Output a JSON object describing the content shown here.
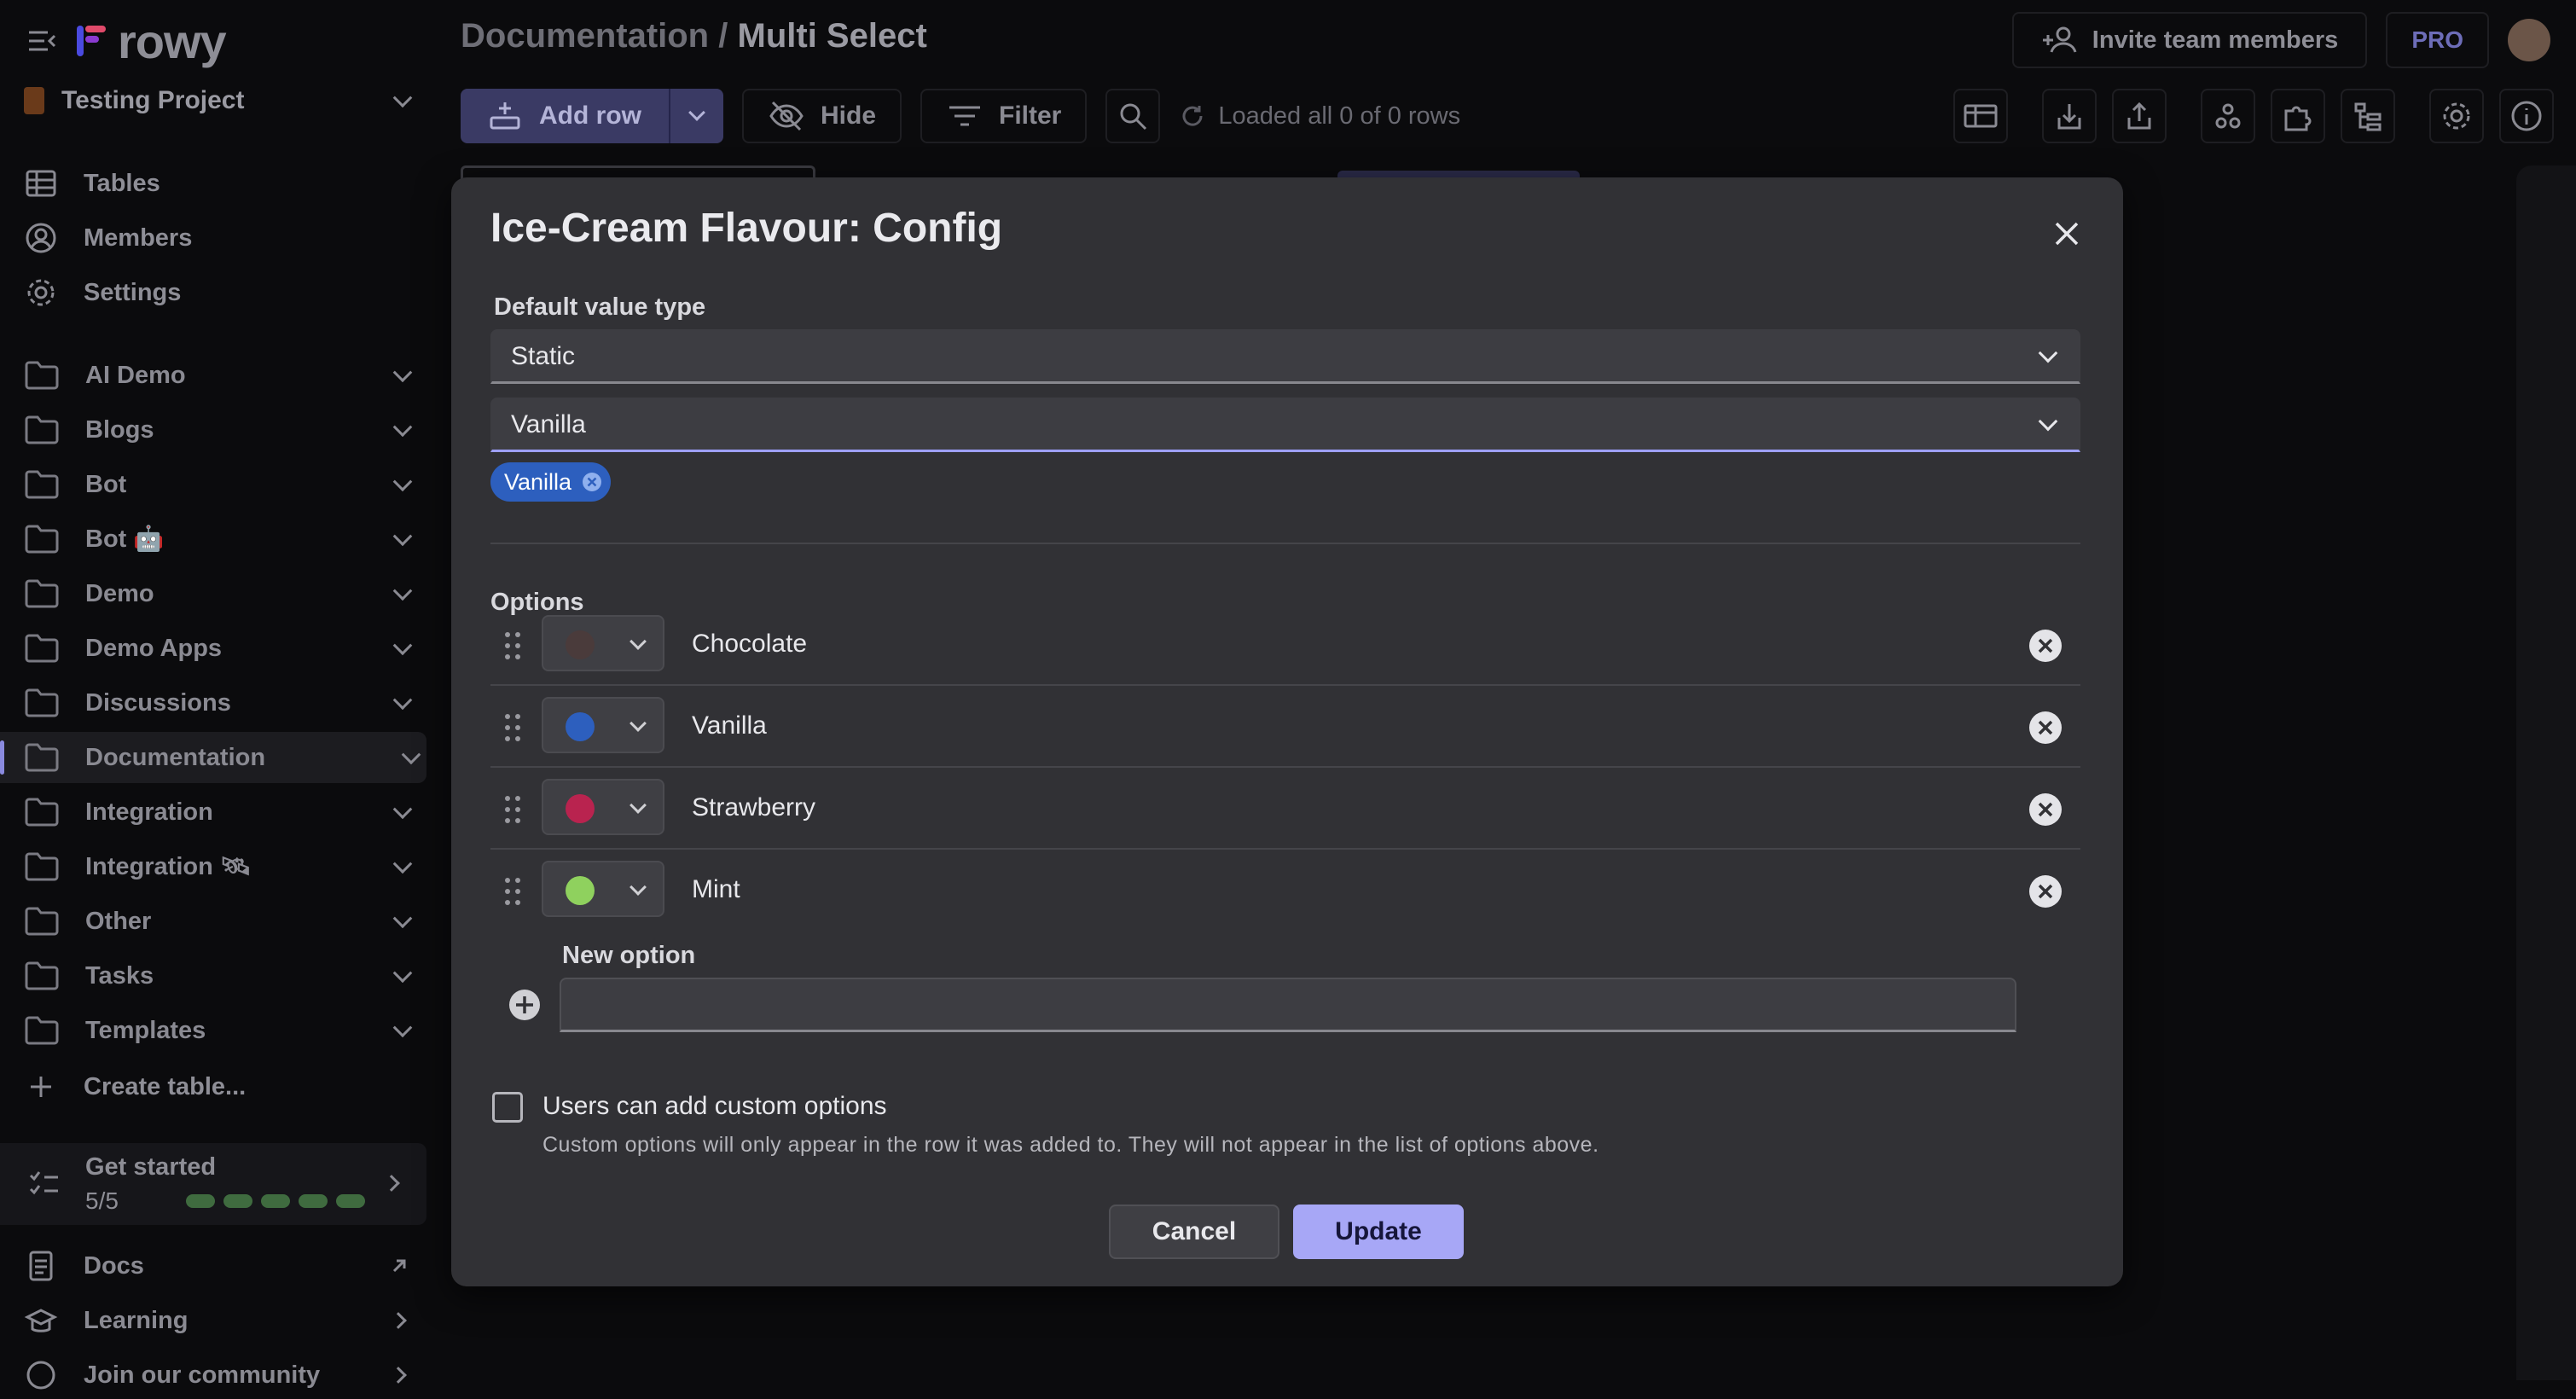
{
  "app": {
    "logo_text": "rowy"
  },
  "sidebar": {
    "project": "Testing Project",
    "nav": [
      {
        "label": "Tables",
        "icon": "table-icon"
      },
      {
        "label": "Members",
        "icon": "user-circle-icon"
      },
      {
        "label": "Settings",
        "icon": "gear-icon"
      }
    ],
    "folders": [
      "AI Demo",
      "Blogs",
      "Bot",
      "Bot 🤖",
      "Demo",
      "Demo Apps",
      "Discussions",
      "Documentation",
      "Integration",
      "Integration 🛰",
      "Other",
      "Tasks",
      "Templates"
    ],
    "active_folder": "Documentation",
    "create_table": "Create table...",
    "get_started": {
      "title": "Get started",
      "progress": "5/5",
      "completed_fraction": 1.0
    },
    "bottom_links": [
      "Docs",
      "Learning",
      "Join our community"
    ]
  },
  "header": {
    "breadcrumb_parent": "Documentation",
    "breadcrumb_sep": "/",
    "breadcrumb_current": "Multi Select",
    "invite": "Invite team members",
    "plan_badge": "PRO"
  },
  "toolbar": {
    "add_row": "Add row",
    "hide": "Hide",
    "filter": "Filter",
    "loaded": "Loaded all 0 of 0 rows"
  },
  "modal": {
    "title": "Ice-Cream Flavour: Config",
    "default_value_type_label": "Default value type",
    "default_value_type": "Static",
    "default_value": "Vanilla",
    "chips": [
      "Vanilla"
    ],
    "options_label": "Options",
    "options": [
      {
        "label": "Chocolate",
        "color": "#4a3b3b"
      },
      {
        "label": "Vanilla",
        "color": "#2d5fbe"
      },
      {
        "label": "Strawberry",
        "color": "#b9234f"
      },
      {
        "label": "Mint",
        "color": "#8fd15e"
      }
    ],
    "new_option_label": "New option",
    "new_option_value": "",
    "custom_options_label": "Users can add custom options",
    "custom_options_checked": false,
    "custom_options_helper": "Custom options will only appear in the row it was added to. They will not appear in the list of options above.",
    "cancel": "Cancel",
    "update": "Update"
  }
}
